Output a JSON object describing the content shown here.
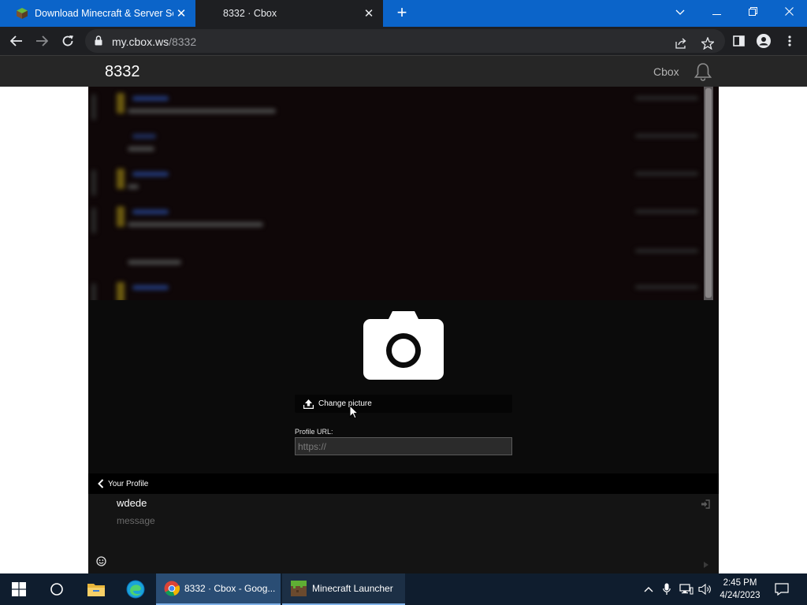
{
  "browser": {
    "tabs": [
      {
        "label": "Download Minecraft & Server Sc",
        "active": false
      },
      {
        "label": "8332 · Cbox",
        "active": true
      }
    ],
    "url_host": "my.cbox.ws",
    "url_path": "/8332"
  },
  "page": {
    "box_title": "8332",
    "brand_link": "Cbox",
    "profile": {
      "change_picture_label": "Change picture",
      "profile_url_label": "Profile URL:",
      "profile_url_placeholder": "https://",
      "back_label": "Your Profile"
    },
    "composer": {
      "username": "wdede",
      "message_placeholder": "message"
    }
  },
  "taskbar": {
    "apps": [
      {
        "label": "8332 · Cbox - Goog...",
        "icon": "chrome-icon"
      },
      {
        "label": "Minecraft Launcher",
        "icon": "minecraft-icon"
      }
    ],
    "time": "2:45 PM",
    "date": "4/24/2023"
  },
  "colors": {
    "tabbar": "#0b64c9",
    "chrome_dark": "#1e1f22",
    "page_header": "#262626",
    "panel": "#0b0b0b",
    "taskbar": "#0f1d2e"
  }
}
